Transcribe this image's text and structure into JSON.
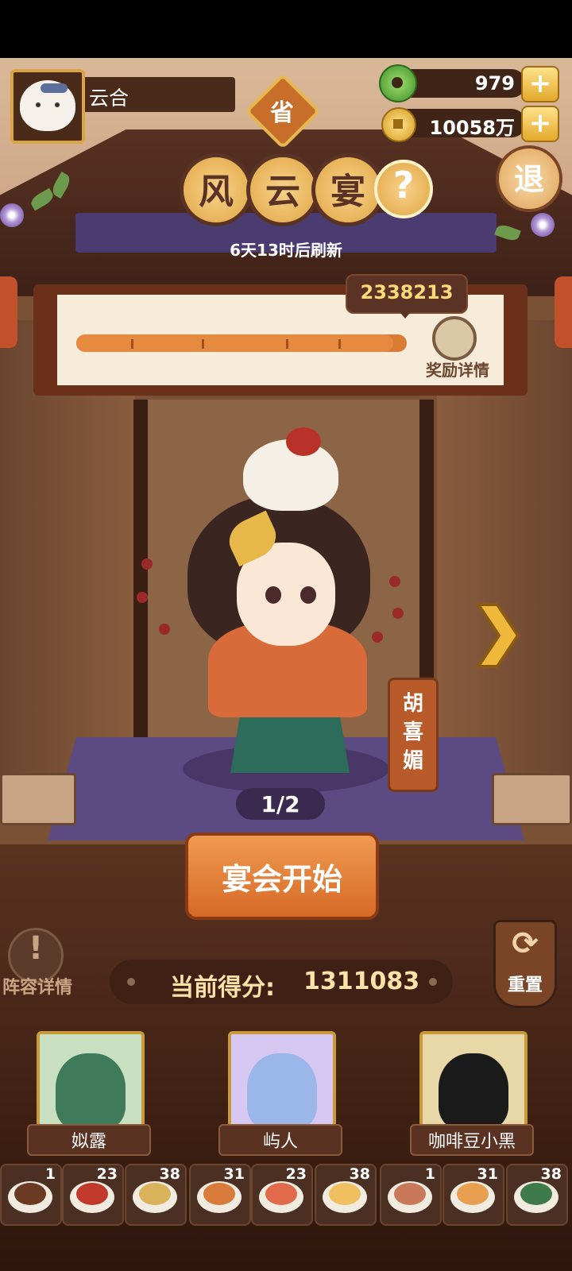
{
  "player": {
    "name": "云合"
  },
  "province_badge": "省",
  "currency": [
    {
      "icon": "jade-coin-icon",
      "value": "979"
    },
    {
      "icon": "gold-coin-icon",
      "value": "10058万"
    }
  ],
  "exit_label": "退",
  "title_chars": [
    "风",
    "云",
    "宴"
  ],
  "help_label": "?",
  "refresh_text": "6天13时后刷新",
  "progress": {
    "target_score": "2338213",
    "fill_fraction": 0.96,
    "reward_label": "奖励详情"
  },
  "character": {
    "name": "胡喜媚",
    "page": "1/2"
  },
  "start_button": "宴会开始",
  "lineup_label": "阵容详情",
  "lineup_icon": "!",
  "reset_label": "重置",
  "current_score": {
    "label": "当前得分:",
    "value": "1311083"
  },
  "heroes": [
    {
      "name": "姒露",
      "bg": "#c8e0c0",
      "head": "#3f7a5a"
    },
    {
      "name": "屿人",
      "bg": "#d6c8f0",
      "head": "#9bb6e8"
    },
    {
      "name": "咖啡豆小黑",
      "bg": "#e8d8a8",
      "head": "#1a1a1a"
    }
  ],
  "dishes": [
    {
      "count": "1",
      "color": "#6a3a22"
    },
    {
      "count": "23",
      "color": "#c0392b"
    },
    {
      "count": "38",
      "color": "#d9b25a"
    },
    {
      "count": "31",
      "color": "#d77a3a"
    },
    {
      "count": "23",
      "color": "#e06a4a"
    },
    {
      "count": "38",
      "color": "#f0c060"
    },
    {
      "count": "1",
      "color": "#c9785a"
    },
    {
      "count": "31",
      "color": "#e8a050"
    },
    {
      "count": "38",
      "color": "#3f7a4a"
    }
  ],
  "colors": {
    "accent_gold": "#e0a644",
    "start_orange": "#d66a26",
    "stage_purple": "#5c4a82"
  }
}
